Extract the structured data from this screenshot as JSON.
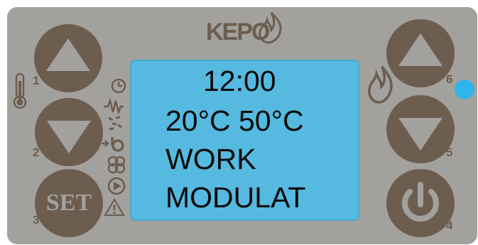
{
  "brand": {
    "logo_text": "KEPO"
  },
  "buttons": {
    "up_left": {
      "number": "1"
    },
    "down_left": {
      "number": "2"
    },
    "set": {
      "number": "3",
      "label": "SET"
    },
    "power": {
      "number": "4"
    },
    "down_right": {
      "number": "5"
    },
    "up_right": {
      "number": "6"
    }
  },
  "display": {
    "lines": [
      "12:00",
      "20°C 50°C",
      "WORK",
      "MODULAT"
    ]
  },
  "status_icons": [
    "clock-icon",
    "heater-icon",
    "pellet-icon",
    "pump-icon",
    "fan-icon",
    "play-icon",
    "warning-icon"
  ],
  "side_icons": [
    "thermometer-icon",
    "flame-icon"
  ],
  "colors": {
    "panel": "#a3a19d",
    "button": "#6c5d4f",
    "display": "#56b9df",
    "led": "#2fb4ec"
  }
}
